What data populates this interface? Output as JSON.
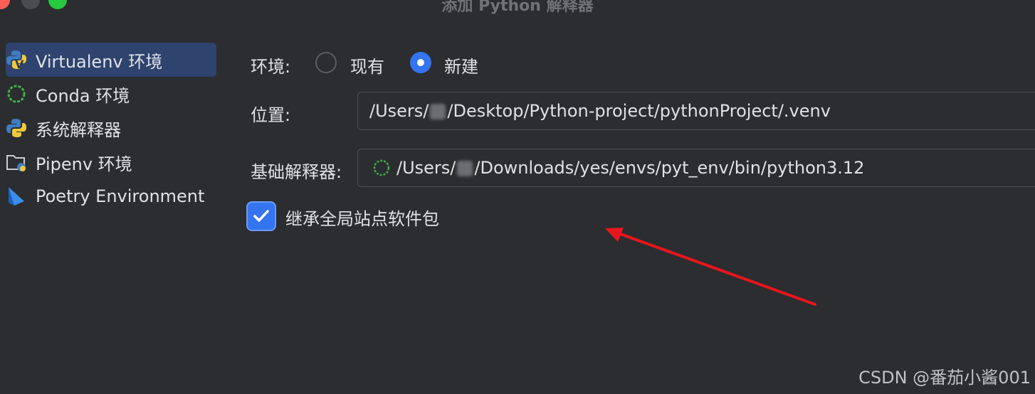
{
  "window": {
    "title": "添加 Python 解释器"
  },
  "sidebar": {
    "items": [
      {
        "label": "Virtualenv 环境",
        "icon": "virtualenv-icon",
        "selected": true
      },
      {
        "label": "Conda 环境",
        "icon": "conda-icon",
        "selected": false
      },
      {
        "label": "系统解释器",
        "icon": "python-icon",
        "selected": false
      },
      {
        "label": "Pipenv 环境",
        "icon": "pipenv-folder-icon",
        "selected": false
      },
      {
        "label": "Poetry Environment",
        "icon": "poetry-icon",
        "selected": false
      }
    ]
  },
  "form": {
    "environment": {
      "label": "环境:",
      "options": [
        {
          "label": "现有",
          "checked": false
        },
        {
          "label": "新建",
          "checked": true
        }
      ]
    },
    "location": {
      "label": "位置:",
      "value_prefix": "/Users/",
      "value_suffix": "/Desktop/Python-project/pythonProject/.venv"
    },
    "base_interpreter": {
      "label": "基础解释器:",
      "value_prefix": "/Users/",
      "value_suffix": "/Downloads/yes/envs/pyt_env/bin/python3.12"
    },
    "inherit_packages": {
      "label": "继承全局站点软件包",
      "checked": true
    }
  },
  "annotation": {
    "arrow_color": "#e8161c"
  },
  "watermark": "CSDN @番茄小酱001",
  "colors": {
    "accent": "#3574f0",
    "background": "#2b2d30",
    "selected_row": "#2e436e"
  }
}
